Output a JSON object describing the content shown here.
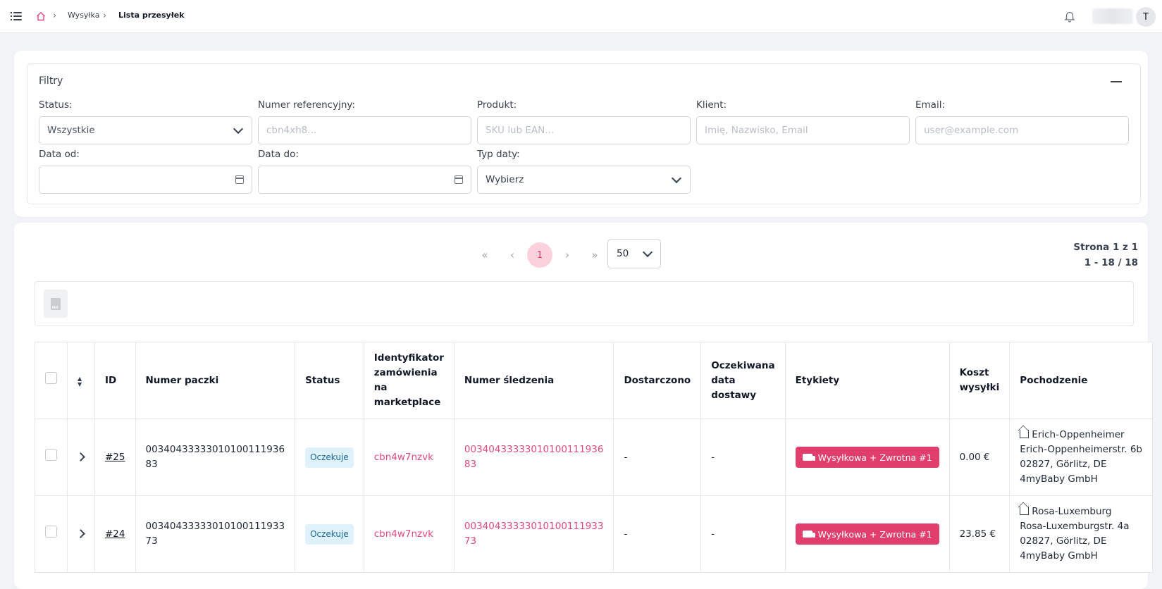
{
  "breadcrumb": {
    "items": [
      "Wysyłka",
      "Lista przesyłek"
    ]
  },
  "header": {
    "avatar_initial": "T"
  },
  "filters": {
    "title": "Filtry",
    "status": {
      "label": "Status:",
      "value": "Wszystkie"
    },
    "reference": {
      "label": "Numer referencyjny:",
      "placeholder": "cbn4xh8..."
    },
    "product": {
      "label": "Produkt:",
      "placeholder": "SKU lub EAN..."
    },
    "client": {
      "label": "Klient:",
      "placeholder": "Imię, Nazwisko, Email"
    },
    "email": {
      "label": "Email:",
      "placeholder": "user@example.com"
    },
    "date_from": {
      "label": "Data od:"
    },
    "date_to": {
      "label": "Data do:"
    },
    "date_type": {
      "label": "Typ daty:",
      "value": "Wybierz"
    }
  },
  "pagination": {
    "current_page": "1",
    "per_page": "50",
    "page_info": "Strona 1 z 1",
    "range_info": "1 - 18 / 18"
  },
  "table": {
    "headers": {
      "id": "ID",
      "package_number": "Numer paczki",
      "status": "Status",
      "marketplace_id": "Identyfikator zamówienia na marketplace",
      "tracking": "Numer śledzenia",
      "delivered": "Dostarczono",
      "expected": "Oczekiwana data dostawy",
      "labels": "Etykiety",
      "cost": "Koszt wysyłki",
      "origin": "Pochodzenie"
    },
    "rows": [
      {
        "id": "#25",
        "package_number": "00340433333010100111936 83",
        "status": "Oczekuje",
        "marketplace_id": "cbn4w7nzvk",
        "tracking": "00340433333010100111936 83",
        "delivered": "-",
        "expected": "-",
        "label": "Wysyłkowa + Zwrotna #1",
        "cost": "0.00 €",
        "origin_name": "Erich-Oppenheimer",
        "origin_street": "Erich-Oppenheimerstr. 6b",
        "origin_city": "02827, Görlitz, DE",
        "origin_company": "4myBaby GmbH"
      },
      {
        "id": "#24",
        "package_number": "00340433333010100111933 73",
        "status": "Oczekuje",
        "marketplace_id": "cbn4w7nzvk",
        "tracking": "00340433333010100111933 73",
        "delivered": "-",
        "expected": "-",
        "label": "Wysyłkowa + Zwrotna #1",
        "cost": "23.85 €",
        "origin_name": "Rosa-Luxemburg",
        "origin_street": "Rosa-Luxemburgstr. 4a",
        "origin_city": "02827, Görlitz, DE",
        "origin_company": "4myBaby GmbH"
      }
    ]
  }
}
